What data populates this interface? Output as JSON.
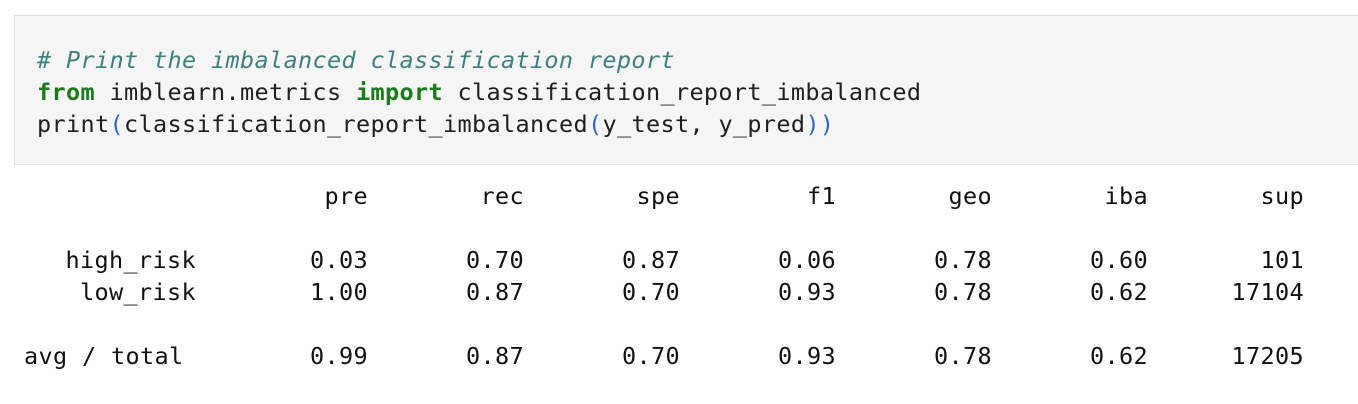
{
  "code": {
    "comment": "# Print the imbalanced classification report",
    "line2": {
      "kw_from": "from",
      "module": " imblearn.metrics ",
      "kw_import": "import",
      "name": " classification_report_imbalanced"
    },
    "line3": {
      "func": "print",
      "open1": "(",
      "inner": "classification_report_imbalanced",
      "open2": "(",
      "args": "y_test, y_pred",
      "close": "))"
    }
  },
  "report": {
    "headers": [
      "pre",
      "rec",
      "spe",
      "f1",
      "geo",
      "iba",
      "sup"
    ],
    "rows": [
      {
        "label": "high_risk",
        "values": [
          "0.03",
          "0.70",
          "0.87",
          "0.06",
          "0.78",
          "0.60",
          "101"
        ]
      },
      {
        "label": "low_risk",
        "values": [
          "1.00",
          "0.87",
          "0.70",
          "0.93",
          "0.78",
          "0.62",
          "17104"
        ]
      },
      {
        "label": "avg / total",
        "values": [
          "0.99",
          "0.87",
          "0.70",
          "0.93",
          "0.78",
          "0.62",
          "17205"
        ]
      }
    ]
  },
  "colors": {
    "comment": "#3f7f7f",
    "keyword": "#1b7a1b",
    "paren": "#2d67c8",
    "cell_background": "#f5f5f5"
  }
}
